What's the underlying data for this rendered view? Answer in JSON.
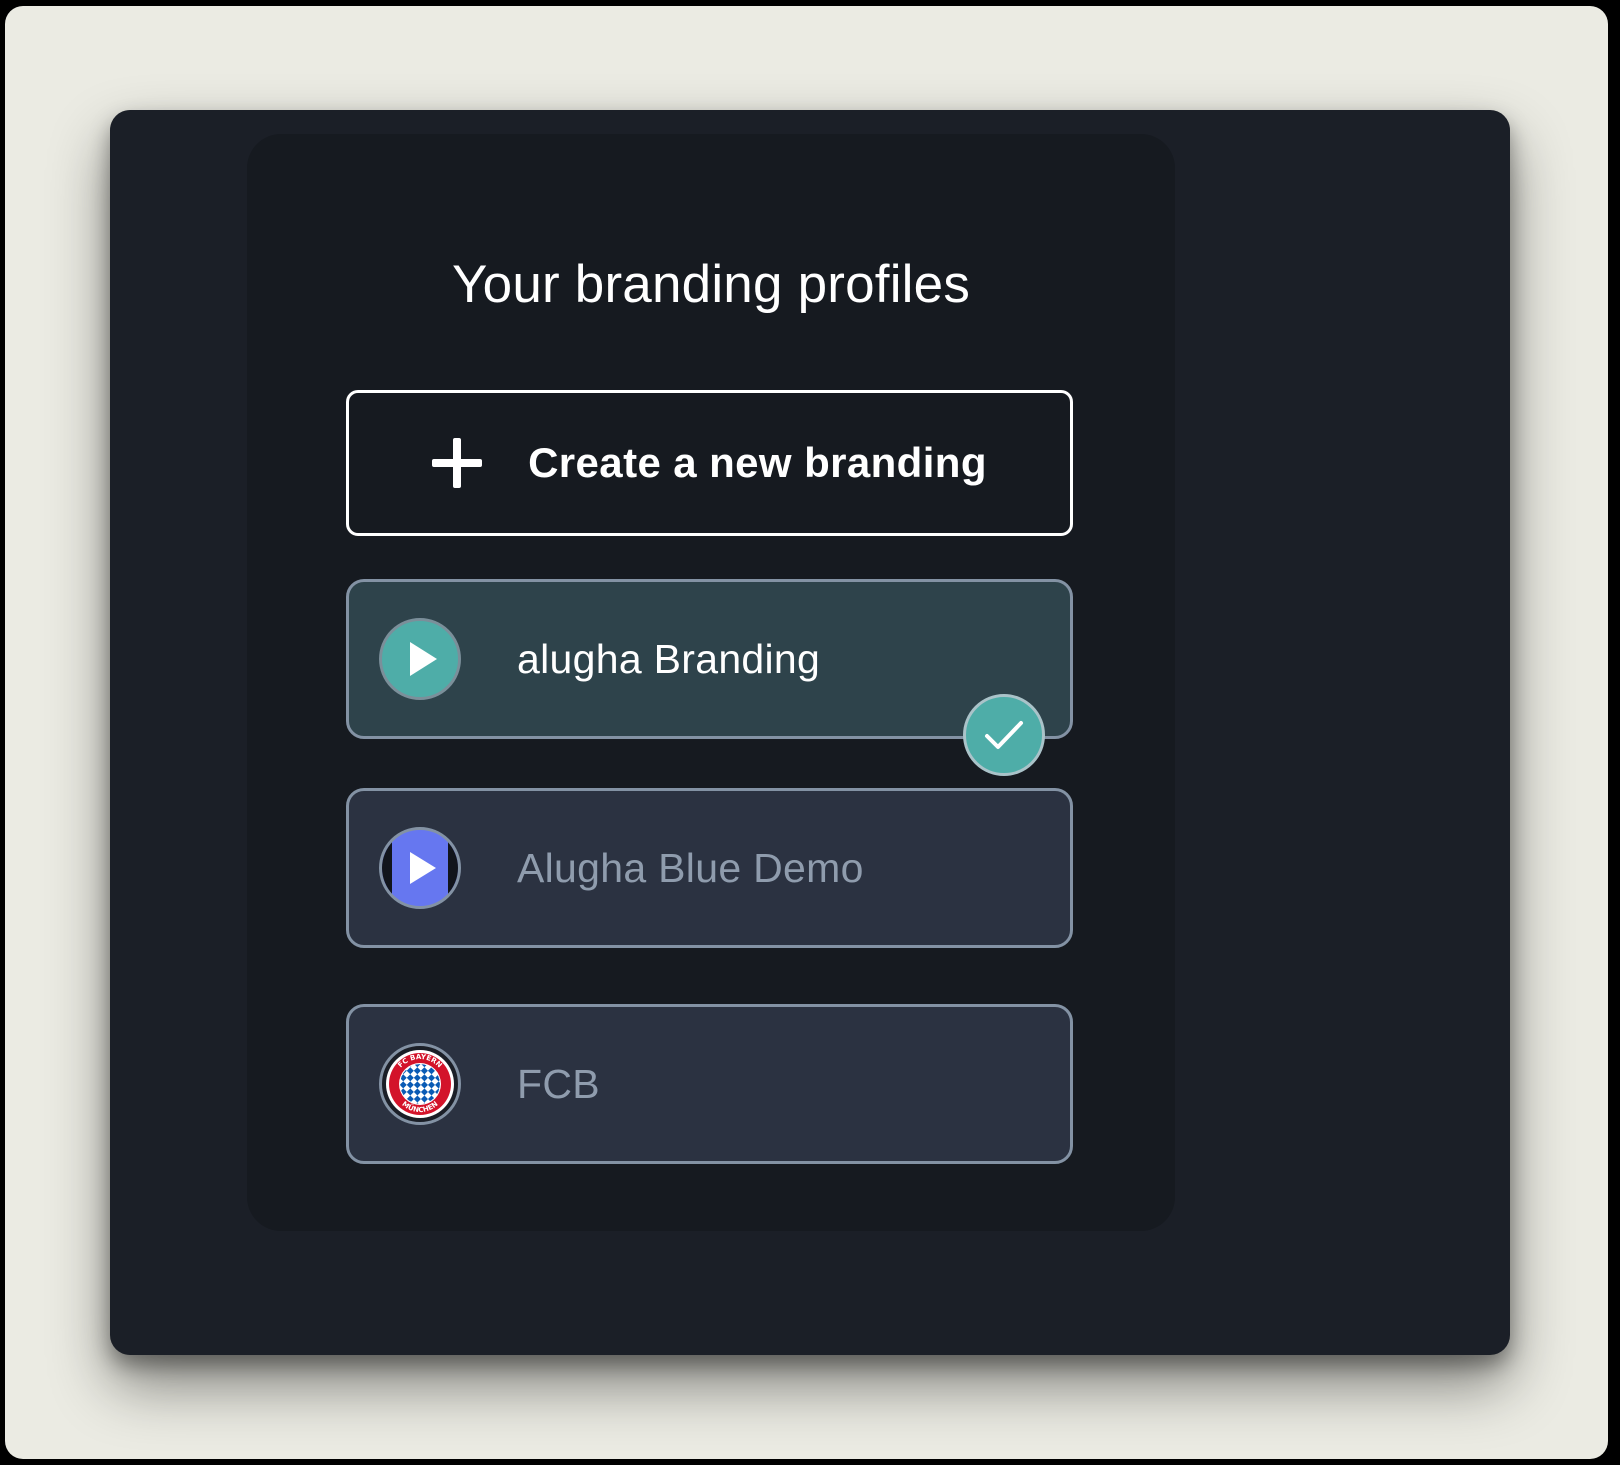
{
  "panel": {
    "title": "Your branding profiles"
  },
  "create_button": {
    "icon": "plus-icon",
    "label": "Create a new branding"
  },
  "profiles": [
    {
      "name": "alugha Branding",
      "icon": "play-icon",
      "selected": true,
      "avatar_color": "#4eada8"
    },
    {
      "name": "Alugha Blue Demo",
      "icon": "play-icon",
      "selected": false,
      "avatar_color": "#6677f0"
    },
    {
      "name": "FCB",
      "icon": "fc-bayern-logo",
      "selected": false,
      "logo_text": "FC BAYERN MÜNCHEN"
    }
  ],
  "colors": {
    "accent": "#4eada8",
    "window_bg": "#1b1f27",
    "panel_bg": "#161a20",
    "selected_bg": "#2e434b",
    "card_bg": "#2b3241",
    "card_border": "#8392a4"
  }
}
